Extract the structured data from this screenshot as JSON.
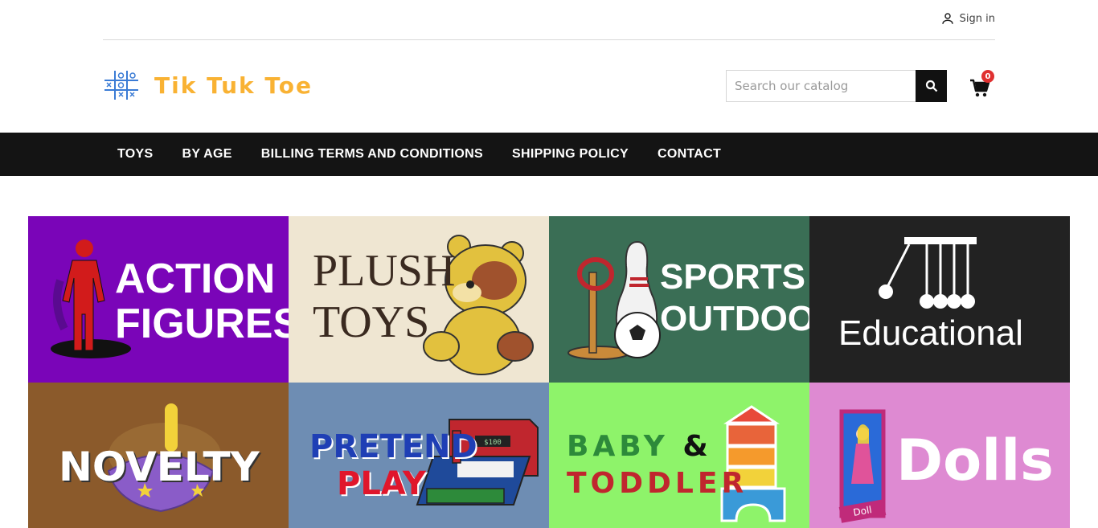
{
  "account": {
    "sign_in_label": "Sign in"
  },
  "brand": {
    "name": "Tik Tuk Toe"
  },
  "search": {
    "placeholder": "Search our catalog"
  },
  "cart": {
    "count": "0"
  },
  "nav": {
    "items": [
      {
        "label": "TOYS"
      },
      {
        "label": "BY AGE"
      },
      {
        "label": "BILLING TERMS AND CONDITIONS"
      },
      {
        "label": "SHIPPING POLICY"
      },
      {
        "label": "CONTACT"
      }
    ]
  },
  "categories": [
    {
      "line1": "ACTION",
      "line2": "FIGURES",
      "color": "#7a05b8"
    },
    {
      "line1": "PLUSH",
      "line2": "TOYS",
      "color": "#efe6d2"
    },
    {
      "line1": "SPORTS &",
      "line2": "OUTDOOR",
      "color": "#3a6e55"
    },
    {
      "line1": "Educational",
      "color": "#222222"
    },
    {
      "line1": "NOVELTY",
      "color": "#8b5a2b"
    },
    {
      "line1": "PRETEND",
      "line2": "PLAY",
      "color": "#6e8db3",
      "register_display": "$100"
    },
    {
      "line1": "BABY",
      "line2": "TODDLER",
      "amp": "&",
      "color": "#8ef36a"
    },
    {
      "line1": "Dolls",
      "box_label": "Doll",
      "color": "#de8ad2"
    }
  ],
  "theme": {
    "accent": "#f9b233",
    "nav_bg": "#141414",
    "badge": "#e03131"
  }
}
